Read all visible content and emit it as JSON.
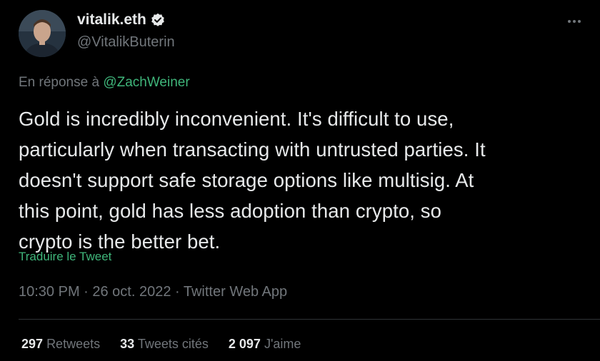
{
  "author": {
    "display_name": "vitalik.eth",
    "handle": "@VitalikButerin",
    "verified_icon": "verified-badge-icon"
  },
  "reply": {
    "prefix": "En réponse à",
    "mention": "@ZachWeiner"
  },
  "tweet": {
    "text_lines": [
      "Gold is incredibly inconvenient. It's difficult to use,",
      "particularly when transacting with untrusted parties. It",
      "doesn't support safe storage options like multisig. At",
      "this point, gold has less adoption than crypto, so",
      "crypto is the better bet."
    ],
    "translate_label": "Traduire le Tweet",
    "timestamp": "10:30 PM · 26 oct. 2022 · Twitter Web App"
  },
  "stats": [
    {
      "count": "297",
      "label": "Retweets"
    },
    {
      "count": "33",
      "label": "Tweets cités"
    },
    {
      "count": "2 097",
      "label": "J'aime"
    }
  ],
  "colors": {
    "background": "#000000",
    "text": "#e7e9ea",
    "muted": "#71767b",
    "link": "#3fb57a",
    "divider": "#2f3336"
  }
}
